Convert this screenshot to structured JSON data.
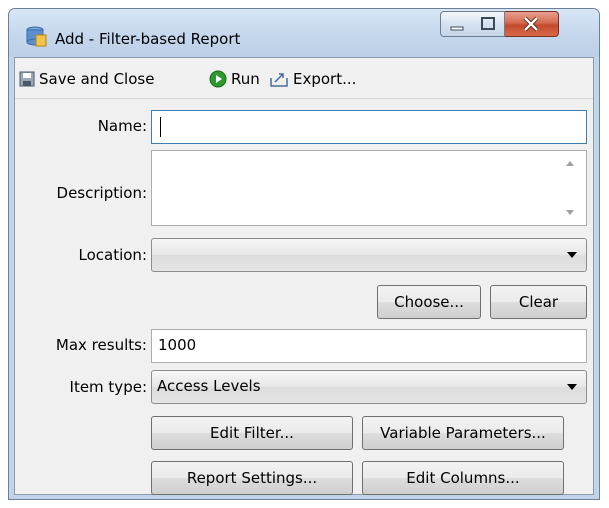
{
  "window": {
    "title": "Add - Filter-based Report"
  },
  "toolbar": {
    "save_label": "Save and Close",
    "run_label": "Run",
    "export_label": "Export..."
  },
  "form": {
    "name_label": "Name:",
    "name_value": "",
    "description_label": "Description:",
    "description_value": "",
    "location_label": "Location:",
    "location_value": "",
    "choose_label": "Choose...",
    "clear_label": "Clear",
    "max_results_label": "Max results:",
    "max_results_value": "1000",
    "item_type_label": "Item type:",
    "item_type_value": "Access Levels"
  },
  "buttons": {
    "edit_filter": "Edit Filter...",
    "variable_parameters": "Variable Parameters...",
    "report_settings": "Report Settings...",
    "edit_columns": "Edit Columns..."
  },
  "colors": {
    "close_button": "#c44a2e",
    "run_icon": "#2e9a2e",
    "title_bar": "#c3d6ec"
  }
}
